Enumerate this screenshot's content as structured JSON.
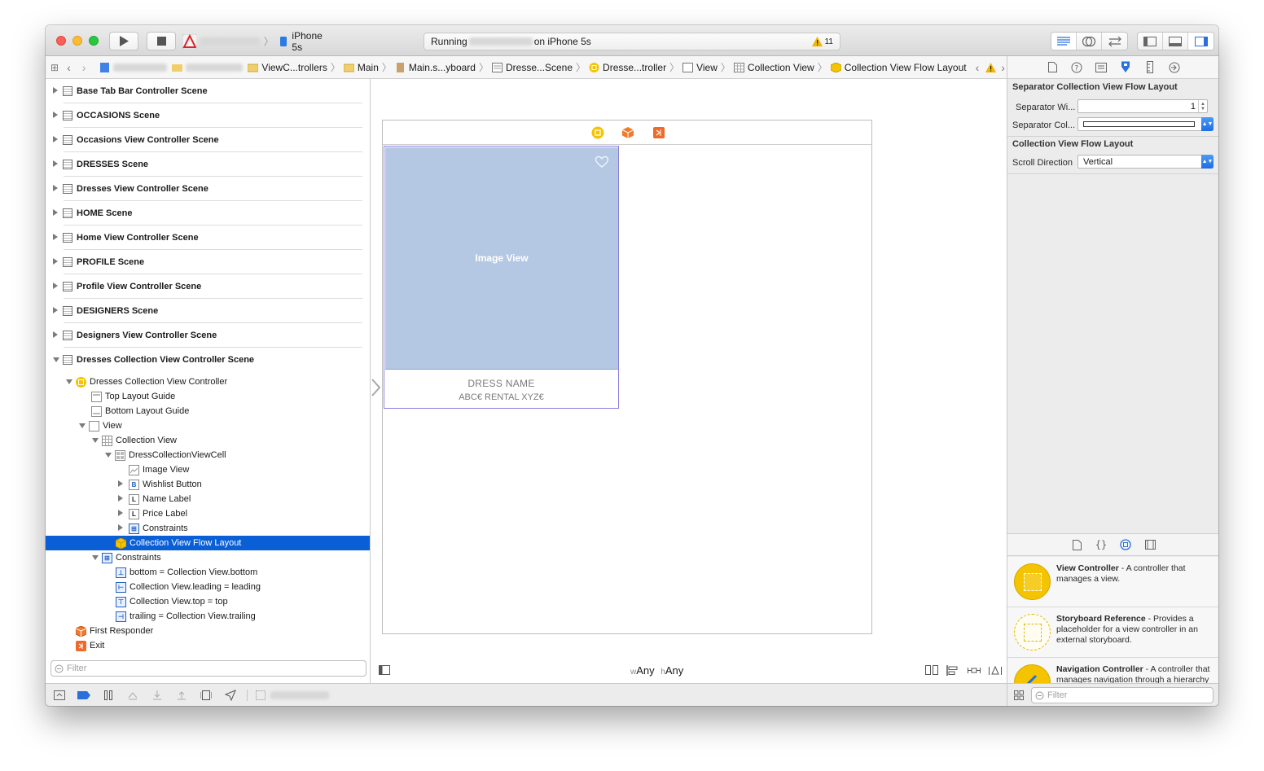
{
  "toolbar": {
    "scheme_device": "iPhone 5s",
    "status_prefix": "Running",
    "status_suffix": "on iPhone 5s",
    "warning_count": "11"
  },
  "jumpbar": {
    "crumbs": [
      "ViewC...trollers",
      "Main",
      "Main.s...yboard",
      "Dresse...Scene",
      "Dresse...troller",
      "View",
      "Collection View",
      "Collection View Flow Layout"
    ]
  },
  "navigator": {
    "scenes": [
      "Base Tab Bar Controller Scene",
      "OCCASIONS Scene",
      "Occasions View Controller Scene",
      "DRESSES Scene",
      "Dresses View Controller Scene",
      "HOME Scene",
      "Home View Controller Scene",
      "PROFILE Scene",
      "Profile View Controller Scene",
      "DESIGNERS Scene",
      "Designers View Controller Scene",
      "Dresses Collection View Controller Scene"
    ],
    "tree": [
      "Dresses Collection View Controller",
      "Top Layout Guide",
      "Bottom Layout Guide",
      "View",
      "Collection View",
      "DressCollectionViewCell",
      "Image View",
      "Wishlist Button",
      "Name Label",
      "Price Label",
      "Constraints",
      "Collection View Flow Layout",
      "Constraints",
      "bottom = Collection View.bottom",
      "Collection View.leading = leading",
      "Collection View.top = top",
      "trailing = Collection View.trailing",
      "First Responder",
      "Exit"
    ],
    "filter_placeholder": "Filter"
  },
  "canvas": {
    "image_view_label": "Image View",
    "dress_name": "DRESS NAME",
    "price_text": "ABC€ RENTAL XYZ€",
    "size_class_w": "Any",
    "size_class_h": "Any",
    "w_prefix": "w",
    "h_prefix": "h"
  },
  "inspector": {
    "section1_title": "Separator Collection View Flow Layout",
    "sep_width_label": "Separator Wi...",
    "sep_width_value": "1",
    "sep_color_label": "Separator Col...",
    "section2_title": "Collection View Flow Layout",
    "scroll_dir_label": "Scroll Direction",
    "scroll_dir_value": "Vertical"
  },
  "library": {
    "items": [
      {
        "title": "View Controller",
        "desc": " - A controller that manages a view."
      },
      {
        "title": "Storyboard Reference",
        "desc": " - Provides a placeholder for a view controller in an external storyboard."
      },
      {
        "title": "Navigation Controller",
        "desc": " - A controller that manages navigation through a hierarchy of views."
      }
    ],
    "filter_placeholder": "Filter"
  },
  "colors": {
    "selection": "#0a5fd7",
    "image_view_fill": "#b4c8e4",
    "accent": "#1d6ee3"
  }
}
